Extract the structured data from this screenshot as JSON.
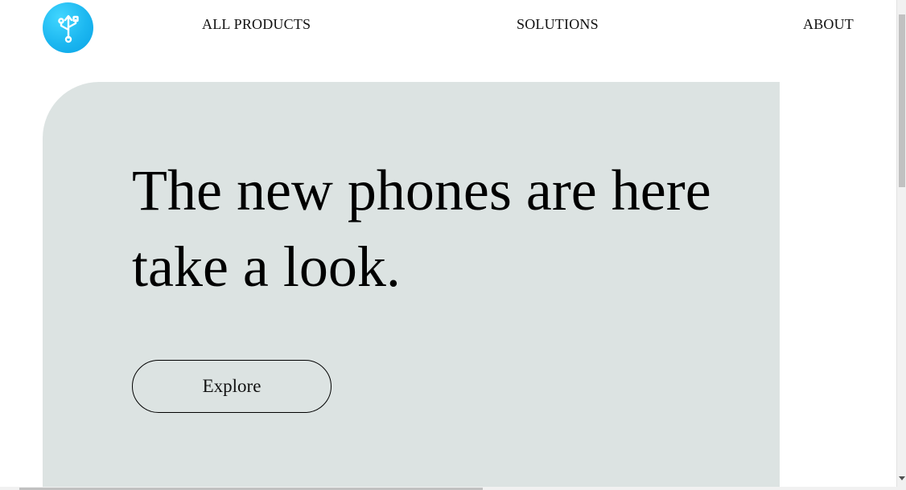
{
  "header": {
    "logo_icon": "usb-icon",
    "nav": [
      {
        "label": "ALL PRODUCTS"
      },
      {
        "label": "SOLUTIONS"
      },
      {
        "label": "ABOUT"
      }
    ]
  },
  "hero": {
    "heading": "The new phones are here take a look.",
    "button_label": "Explore"
  },
  "colors": {
    "logo": "#1cb7f0",
    "hero_background": "#dce3e2",
    "text": "#111111"
  }
}
